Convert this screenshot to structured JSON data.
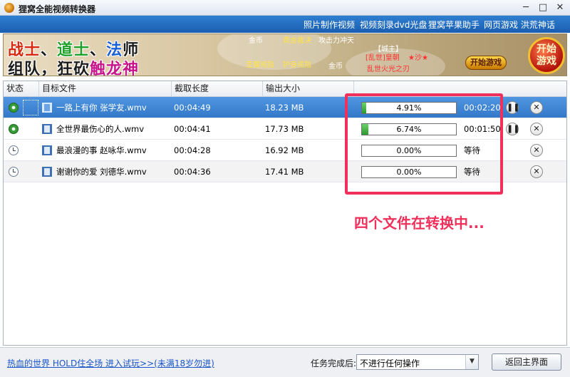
{
  "window": {
    "title": "狸窝全能视频转换器",
    "minimize": "─",
    "maximize": "□",
    "close": "✕"
  },
  "top_links": [
    "照片制作视频",
    "视频刻录dvd光盘",
    "狸窝苹果助手",
    "网页游戏 洪荒神话"
  ],
  "banner": {
    "line1": [
      {
        "text": "战士",
        "color": "#d62a10"
      },
      {
        "text": "、",
        "color": "#1c1c1c"
      },
      {
        "text": "道士",
        "color": "#1fa02a"
      },
      {
        "text": "、",
        "color": "#1c1c1c"
      },
      {
        "text": "法",
        "color": "#1a5fd6"
      },
      {
        "text": "师",
        "color": "#1c1c1c"
      }
    ],
    "line2_a": "组队，狂砍",
    "line2_b": "触龙神",
    "line2_b_color": "#c8148a",
    "game_texts": [
      {
        "text": "金币",
        "color": "#ffffff"
      },
      {
        "text": "黄金裁决",
        "color": "#ffe24a"
      },
      {
        "text": "攻击力冲天",
        "color": "#ffffff"
      },
      {
        "text": "【城主】",
        "color": "#ffffff"
      },
      {
        "text": "圣魔戒指",
        "color": "#ffe24a"
      },
      {
        "text": "护身戒指",
        "color": "#ffe24a"
      },
      {
        "text": "金币",
        "color": "#ffffff"
      },
      {
        "text": "[乱世]皇朝",
        "color": "#ff3030"
      },
      {
        "text": "★沙★",
        "color": "#ff3030"
      },
      {
        "text": "乱世火光之刃",
        "color": "#ff3030"
      }
    ],
    "start_button": "开始游戏",
    "start_circle_1": "开始",
    "start_circle_2": "游戏"
  },
  "table": {
    "columns": [
      "状态",
      "目标文件",
      "截取长度",
      "输出大小"
    ],
    "rows": [
      {
        "status": "running",
        "file": "一路上有你 张学友.wmv",
        "length": "00:04:49",
        "size": "18.23 MB",
        "progress": 4.91,
        "progress_text": "4.91%",
        "time": "00:02:20",
        "has_pause": true,
        "selected": true
      },
      {
        "status": "running",
        "file": "全世界最伤心的人.wmv",
        "length": "00:04:41",
        "size": "17.73 MB",
        "progress": 6.74,
        "progress_text": "6.74%",
        "time": "00:01:50",
        "has_pause": true,
        "selected": false
      },
      {
        "status": "waiting",
        "file": "最浪漫的事 赵咏华.wmv",
        "length": "00:04:28",
        "size": "16.92 MB",
        "progress": 0,
        "progress_text": "0.00%",
        "time": "等待",
        "has_pause": false,
        "selected": false
      },
      {
        "status": "waiting",
        "file": "谢谢你的爱 刘德华.wmv",
        "length": "00:04:36",
        "size": "17.41 MB",
        "progress": 0,
        "progress_text": "0.00%",
        "time": "等待",
        "has_pause": false,
        "selected": false
      }
    ]
  },
  "annotation": "四个文件在转换中...",
  "footer": {
    "link": "热血的世界 HOLD住全场 进入试玩>>(未满18岁勿进)",
    "after_task_label": "任务完成后:",
    "after_task_value": "不进行任何操作",
    "home_button": "返回主界面"
  },
  "colors": {
    "selected_row": "#3479c9",
    "progress_fill": "#2d9a2d",
    "annotation": "#f0305a",
    "link_bar": "#1a5eb0"
  }
}
